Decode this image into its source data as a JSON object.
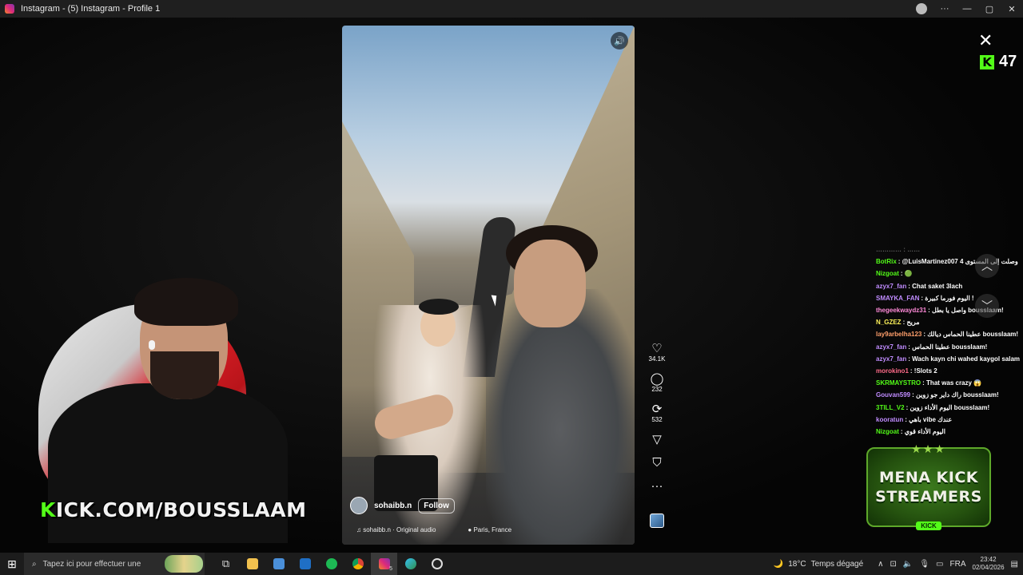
{
  "window": {
    "title": "Instagram - (5) Instagram - Profile 1",
    "min_icon": "minimize-icon",
    "max_icon": "maximize-icon",
    "close_icon": "close-icon",
    "menu_icon": "more-icon"
  },
  "reel": {
    "author": "sohaibb.n",
    "follow_label": "Follow",
    "audio": "sohaibb.n · Original audio",
    "location": "Paris, France",
    "mute_icon": "speaker-icon",
    "actions": {
      "likes": "34.1K",
      "comments": "232",
      "reposts": "532"
    }
  },
  "overlay": {
    "close_glyph": "✕",
    "kick_logo": "K",
    "viewer_count": "47",
    "banner_k": "K",
    "banner_rest": "ICK.COM/BOUSSLAAM"
  },
  "chat": {
    "messages": [
      {
        "user": "BotRix",
        "user_color": "#53fc18",
        "text": ": @LuisMartinez007 وصلت إلى المستوى 4"
      },
      {
        "user": "Nizgoat",
        "user_color": "#53fc18",
        "text": ": 🟢"
      },
      {
        "user": "azyx7_fan",
        "user_color": "#c08cff",
        "text": ": Chat saket 3lach"
      },
      {
        "user": "SMAYKA_FAN",
        "user_color": "#c08cff",
        "text": ": اليوم فورما كبيرة !"
      },
      {
        "user": "thegeekwaydz31",
        "user_color": "#ff8ad8",
        "text": ": واصل يا بطل bousslaam!"
      },
      {
        "user": "N_GZEZ",
        "user_color": "#fff35a",
        "text": ": مريح"
      },
      {
        "user": "lay9arbelha123",
        "user_color": "#ff9f6b",
        "text": ": عطينا الحماس ديالك bousslaam!"
      },
      {
        "user": "azyx7_fan",
        "user_color": "#c08cff",
        "text": ": عطينا الحماس bousslaam!"
      },
      {
        "user": "azyx7_fan",
        "user_color": "#c08cff",
        "text": ": Wach kayn chi wahed kaygol salam"
      },
      {
        "user": "morokino1",
        "user_color": "#ff6b8a",
        "text": ": !Slots 2"
      },
      {
        "user": "SKRMAYSTRO",
        "user_color": "#53fc18",
        "text": ": That was crazy 😱"
      },
      {
        "user": "Gouvan599",
        "user_color": "#c08cff",
        "text": ": راك داير جو زوين bousslaam!"
      },
      {
        "user": "3TILL_V2",
        "user_color": "#53fc18",
        "text": ": اليوم الأداء زوين bousslaam!"
      },
      {
        "user": "kooratun",
        "user_color": "#c08cff",
        "text": ": باهي vibe عندك"
      },
      {
        "user": "Nizgoat",
        "user_color": "#53fc18",
        "text": ": اليوم الأداء قوي"
      }
    ],
    "nav_up": "︿",
    "nav_down": "﹀"
  },
  "badge": {
    "line1": "MENA KICK",
    "line2": "STREAMERS",
    "tag": "KICK",
    "stars": "★★★"
  },
  "taskbar": {
    "search_placeholder": "Tapez ici pour effectuer une",
    "temperature": "18°C",
    "weather_text": "Temps dégagé",
    "language": "FRA",
    "time": "23:42",
    "date": "02/04/2026",
    "ig_badge": "5"
  },
  "colors": {
    "kick_green": "#53fc18",
    "titlebar": "#1f1f1f",
    "taskbar": "#1c1c1c"
  }
}
